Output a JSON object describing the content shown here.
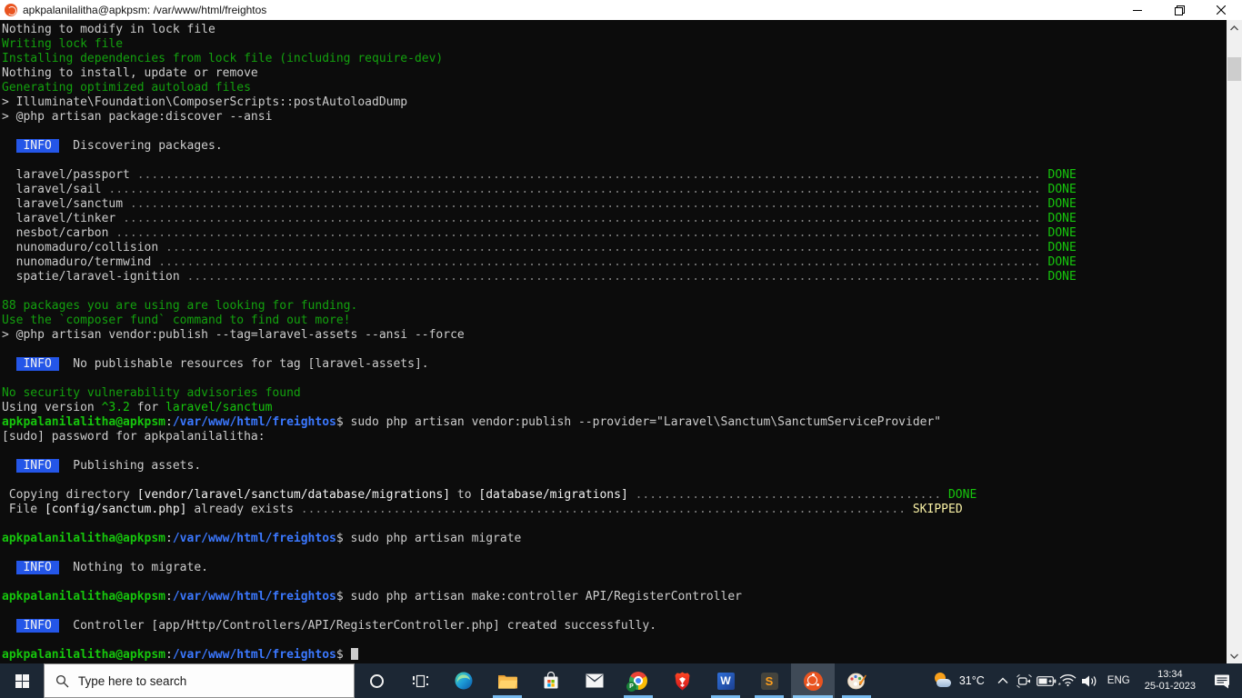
{
  "palette": {
    "terminal_bg": "#0c0c0c",
    "terminal_fg": "#cccccc",
    "green": "#13a10e",
    "bright_green": "#16c60c",
    "path_blue": "#3b78ff",
    "info_badge_bg": "#2456e8",
    "skipped_yellow": "#f9f1a5",
    "titlebar_bg": "#ffffff",
    "taskbar_bg": "#1c2734",
    "taskbar_underline": "#76b9ed",
    "ubuntu_orange": "#e95420"
  },
  "window": {
    "title": "apkpalanilalitha@apkpsm: /var/www/html/freightos",
    "controls": [
      "minimize",
      "restore",
      "close"
    ]
  },
  "terminal": {
    "prompt": {
      "user": "apkpalanilalitha@apkpsm",
      "colon": ":",
      "path": "/var/www/html/freightos",
      "dollar": "$"
    },
    "lines": [
      {
        "t": "seg",
        "segs": [
          [
            "Nothing to modify in lock file",
            "fg"
          ]
        ]
      },
      {
        "t": "seg",
        "segs": [
          [
            "Writing lock file",
            "green"
          ]
        ]
      },
      {
        "t": "seg",
        "segs": [
          [
            "Installing dependencies from lock file (including require-dev)",
            "green"
          ]
        ]
      },
      {
        "t": "seg",
        "segs": [
          [
            "Nothing to install, update or remove",
            "fg"
          ]
        ]
      },
      {
        "t": "seg",
        "segs": [
          [
            "Generating optimized autoload files",
            "green"
          ]
        ]
      },
      {
        "t": "seg",
        "segs": [
          [
            "> Illuminate\\Foundation\\ComposerScripts::postAutoloadDump",
            "fg"
          ]
        ]
      },
      {
        "t": "seg",
        "segs": [
          [
            "> @php artisan package:discover --ansi",
            "fg"
          ]
        ]
      },
      {
        "t": "blank"
      },
      {
        "t": "badge",
        "label": " INFO ",
        "segs": [
          [
            "Discovering packages.",
            "fg"
          ]
        ]
      },
      {
        "t": "blank"
      },
      {
        "t": "leader",
        "name": "laravel/passport",
        "dots": 127,
        "status": "DONE",
        "sc": "bgreen"
      },
      {
        "t": "leader",
        "name": "laravel/sail",
        "dots": 131,
        "status": "DONE",
        "sc": "bgreen"
      },
      {
        "t": "leader",
        "name": "laravel/sanctum",
        "dots": 128,
        "status": "DONE",
        "sc": "bgreen"
      },
      {
        "t": "leader",
        "name": "laravel/tinker",
        "dots": 129,
        "status": "DONE",
        "sc": "bgreen"
      },
      {
        "t": "leader",
        "name": "nesbot/carbon",
        "dots": 130,
        "status": "DONE",
        "sc": "bgreen"
      },
      {
        "t": "leader",
        "name": "nunomaduro/collision",
        "dots": 123,
        "status": "DONE",
        "sc": "bgreen"
      },
      {
        "t": "leader",
        "name": "nunomaduro/termwind",
        "dots": 124,
        "status": "DONE",
        "sc": "bgreen"
      },
      {
        "t": "leader",
        "name": "spatie/laravel-ignition",
        "dots": 120,
        "status": "DONE",
        "sc": "bgreen"
      },
      {
        "t": "blank"
      },
      {
        "t": "seg",
        "segs": [
          [
            "88 packages you are using are looking for funding.",
            "green"
          ]
        ]
      },
      {
        "t": "seg",
        "segs": [
          [
            "Use the `composer fund` command to find out more!",
            "green"
          ]
        ]
      },
      {
        "t": "seg",
        "segs": [
          [
            "> @php artisan vendor:publish --tag=laravel-assets --ansi --force",
            "fg"
          ]
        ]
      },
      {
        "t": "blank"
      },
      {
        "t": "badge",
        "label": " INFO ",
        "segs": [
          [
            "No publishable resources for tag [laravel-assets].",
            "fg"
          ]
        ]
      },
      {
        "t": "blank"
      },
      {
        "t": "seg",
        "segs": [
          [
            "No security vulnerability advisories found",
            "green"
          ]
        ]
      },
      {
        "t": "seg",
        "segs": [
          [
            "Using version ",
            "fg"
          ],
          [
            "^3.2",
            "bgreen"
          ],
          [
            " for ",
            "fg"
          ],
          [
            "laravel/sanctum",
            "bgreen"
          ]
        ]
      },
      {
        "t": "prompt",
        "cmd": " sudo php artisan vendor:publish --provider=\"Laravel\\Sanctum\\SanctumServiceProvider\"",
        "cursor": false
      },
      {
        "t": "seg",
        "segs": [
          [
            "[sudo] password for apkpalanilalitha:",
            "fg"
          ]
        ]
      },
      {
        "t": "blank"
      },
      {
        "t": "badge",
        "label": " INFO ",
        "segs": [
          [
            "Publishing assets.",
            "fg"
          ]
        ]
      },
      {
        "t": "blank"
      },
      {
        "t": "leaderseg",
        "segs": [
          [
            " Copying directory ",
            "fg"
          ],
          [
            "[vendor/laravel/sanctum/database/migrations]",
            "white"
          ],
          [
            " to ",
            "fg"
          ],
          [
            "[database/migrations]",
            "white"
          ]
        ],
        "dots": 43,
        "status": "DONE",
        "sc": "bgreen"
      },
      {
        "t": "leaderseg",
        "segs": [
          [
            " File ",
            "fg"
          ],
          [
            "[config/sanctum.php]",
            "white"
          ],
          [
            " already exists",
            "fg"
          ]
        ],
        "dots": 85,
        "status": "SKIPPED",
        "sc": "yellow"
      },
      {
        "t": "blank"
      },
      {
        "t": "prompt",
        "cmd": " sudo php artisan migrate",
        "cursor": false
      },
      {
        "t": "blank"
      },
      {
        "t": "badge",
        "label": " INFO ",
        "segs": [
          [
            "Nothing to migrate.",
            "fg"
          ]
        ]
      },
      {
        "t": "blank"
      },
      {
        "t": "prompt",
        "cmd": " sudo php artisan make:controller API/RegisterController",
        "cursor": false
      },
      {
        "t": "blank"
      },
      {
        "t": "badge",
        "label": " INFO ",
        "segs": [
          [
            "Controller [app/Http/Controllers/API/RegisterController.php] created successfully.",
            "fg"
          ]
        ]
      },
      {
        "t": "blank"
      },
      {
        "t": "prompt",
        "cmd": " ",
        "cursor": true
      }
    ]
  },
  "taskbar": {
    "search_placeholder": "Type here to search",
    "apps": [
      {
        "id": "cortana",
        "open": false,
        "active": false
      },
      {
        "id": "task-view",
        "open": false,
        "active": false
      },
      {
        "id": "edge",
        "open": false,
        "active": false
      },
      {
        "id": "file-explorer",
        "open": true,
        "active": false
      },
      {
        "id": "store",
        "open": false,
        "active": false
      },
      {
        "id": "mail",
        "open": false,
        "active": false
      },
      {
        "id": "chrome",
        "open": true,
        "active": false,
        "badge": "P"
      },
      {
        "id": "brave",
        "open": false,
        "active": false
      },
      {
        "id": "word",
        "open": true,
        "active": false,
        "label": "W"
      },
      {
        "id": "sublime",
        "open": true,
        "active": false,
        "label": "S"
      },
      {
        "id": "ubuntu",
        "open": true,
        "active": true
      },
      {
        "id": "paint3d",
        "open": true,
        "active": false
      }
    ],
    "tray": {
      "temperature": "31°C",
      "language": "ENG",
      "time": "13:34",
      "date": "25-01-2023"
    }
  }
}
